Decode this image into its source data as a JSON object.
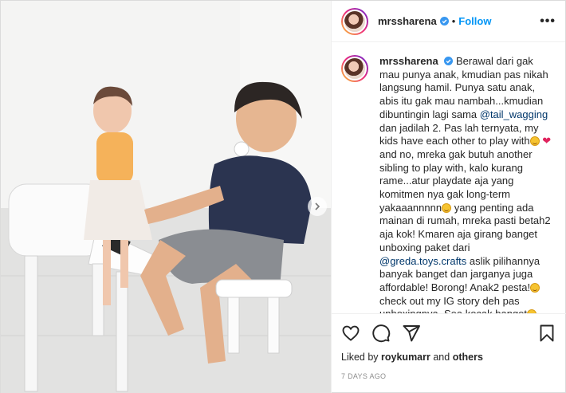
{
  "header": {
    "username": "mrssharena",
    "separator": "•",
    "follow_label": "Follow",
    "more_label": "•••"
  },
  "caption": {
    "username": "mrssharena",
    "part1": "Berawal dari gak mau punya anak, kmudian pas nikah langsung hamil. Punya satu anak, abis itu gak mau nambah...kmudian dibuntingin lagi sama ",
    "mention1": "@tail_wagging",
    "part2": " dan jadilah 2. Pas lah ternyata, my kids have each other to play with",
    "part3": " and no, mreka gak butuh another sibling to play with, kalo kurang rame...atur playdate aja yang komitmen nya gak long-term yakaaannnnn",
    "part4": " yang penting ada mainan di rumah, mreka pasti betah2 aja kok! Kmaren aja girang banget unboxing paket dari ",
    "mention2": "@greda.toys.crafts",
    "part5": " aslik pilihannya banyak banget dan jarganya juga affordable! Borong! Anak2 pesta!",
    "part6": " check out my IG story deh pas unboxingnya. Sea kocak banget",
    "emoji_names": [
      "grinning-emoji",
      "red-heart-emoji",
      "smirking-emoji",
      "grinning-emoji",
      "laughing-emoji"
    ]
  },
  "footer": {
    "liked_prefix": "Liked by ",
    "liked_user": "roykumarr",
    "liked_and": " and ",
    "liked_others": "others",
    "timestamp": "7 DAYS AGO"
  },
  "colors": {
    "accent": "#0095f6",
    "mention": "#00376b",
    "muted": "#8e8e8e",
    "verified": "#3897f0"
  },
  "icons": [
    "like-heart-icon",
    "comment-icon",
    "share-icon",
    "save-bookmark-icon",
    "verified-badge-icon",
    "next-arrow-icon"
  ]
}
